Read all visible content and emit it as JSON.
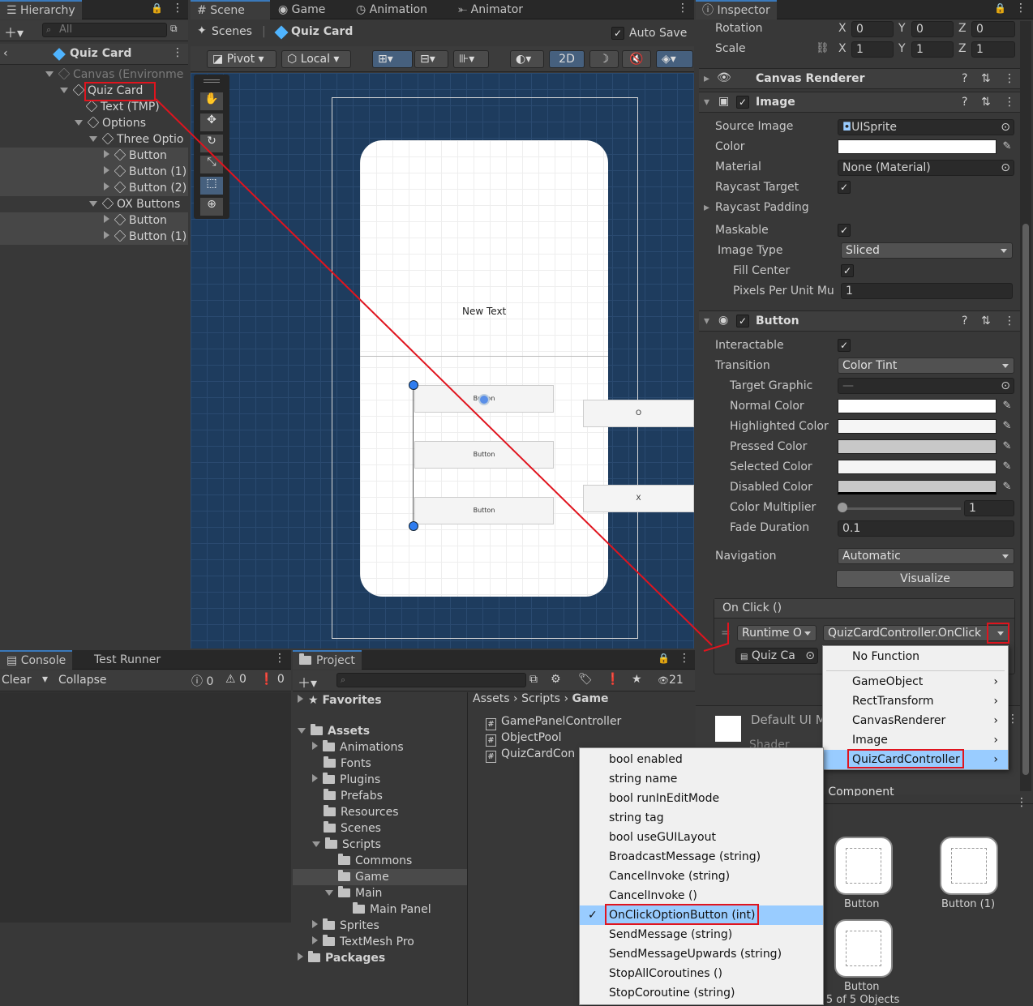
{
  "hierarchy": {
    "tab": "Hierarchy",
    "search_placeholder": "All",
    "scene_title": "Quiz Card",
    "items": [
      {
        "label": "Canvas (Environme"
      },
      {
        "label": "Quiz Card"
      },
      {
        "label": "Text (TMP)"
      },
      {
        "label": "Options"
      },
      {
        "label": "Three Optio"
      },
      {
        "label": "Button"
      },
      {
        "label": "Button (1)"
      },
      {
        "label": "Button (2)"
      },
      {
        "label": "OX Buttons"
      },
      {
        "label": "Button"
      },
      {
        "label": "Button (1)"
      }
    ]
  },
  "scene": {
    "tabs": [
      "Scene",
      "Game",
      "Animation",
      "Animator"
    ],
    "breadcrumb_scenes": "Scenes",
    "breadcrumb_current": "Quiz Card",
    "auto_save": "Auto Save",
    "pivot": "Pivot",
    "local": "Local",
    "mode_2d": "2D",
    "card_text": "New Text",
    "btn1": "Button",
    "btn2": "Button",
    "btn3": "Button",
    "o_label": "O",
    "x_label": "X"
  },
  "inspector": {
    "tab": "Inspector",
    "rotation_label": "Rotation",
    "scale_label": "Scale",
    "axis_x": "X",
    "axis_y": "Y",
    "axis_z": "Z",
    "rotation": [
      "0",
      "0",
      "0"
    ],
    "scale": [
      "1",
      "1",
      "1"
    ],
    "canvas_renderer": "Canvas Renderer",
    "image": {
      "title": "Image",
      "source_image_label": "Source Image",
      "source_image": "UISprite",
      "color_label": "Color",
      "material_label": "Material",
      "material": "None (Material)",
      "raycast_target_label": "Raycast Target",
      "raycast_padding_label": "Raycast Padding",
      "maskable_label": "Maskable",
      "image_type_label": "Image Type",
      "image_type": "Sliced",
      "fill_center_label": "Fill Center",
      "ppu_label": "Pixels Per Unit Mu",
      "ppu": "1"
    },
    "button": {
      "title": "Button",
      "interactable_label": "Interactable",
      "transition_label": "Transition",
      "transition": "Color Tint",
      "target_graphic_label": "Target Graphic",
      "target_graphic": "—",
      "normal_label": "Normal Color",
      "highlighted_label": "Highlighted Color",
      "pressed_label": "Pressed Color",
      "selected_label": "Selected Color",
      "disabled_label": "Disabled Color",
      "multiplier_label": "Color Multiplier",
      "multiplier": "1",
      "fade_label": "Fade Duration",
      "fade": "0.1",
      "navigation_label": "Navigation",
      "navigation": "Automatic",
      "visualize": "Visualize",
      "onclick": "On Click ()",
      "runtime": "Runtime O",
      "function": "QuizCardController.OnClick",
      "object": "Quiz Ca"
    },
    "default_ui": "Default UI M",
    "shader": "Shader",
    "add_component": "d Component"
  },
  "function_menu": {
    "items": [
      "No Function",
      "GameObject",
      "RectTransform",
      "CanvasRenderer",
      "Image",
      "QuizCardController"
    ]
  },
  "method_menu": {
    "items": [
      "bool enabled",
      "string name",
      "bool runInEditMode",
      "string tag",
      "bool useGUILayout",
      "BroadcastMessage (string)",
      "CancelInvoke (string)",
      "CancelInvoke ()",
      "OnClickOptionButton (int)",
      "SendMessage (string)",
      "SendMessageUpwards (string)",
      "StopAllCoroutines ()",
      "StopCoroutine (string)"
    ]
  },
  "console": {
    "tabs": [
      "Console",
      "Test Runner"
    ],
    "clear": "Clear",
    "collapse": "Collapse",
    "counts": [
      "0",
      "0",
      "0"
    ]
  },
  "project": {
    "tab": "Project",
    "count": "21",
    "favorites": "Favorites",
    "assets": "Assets",
    "tree": [
      "Animations",
      "Fonts",
      "Plugins",
      "Prefabs",
      "Resources",
      "Scenes",
      "Scripts",
      "Commons",
      "Game",
      "Main",
      "Main Panel",
      "Sprites",
      "TextMesh Pro"
    ],
    "packages": "Packages",
    "breadcrumb": [
      "Assets",
      "Scripts",
      "Game"
    ],
    "files": [
      "GamePanelController",
      "ObjectPool",
      "QuizCardCon"
    ],
    "preview": [
      "Button",
      "Button (1)",
      "Button"
    ],
    "showing": "wing 5 of 5 Objects"
  },
  "colors": {
    "accent": "#3a79bb",
    "annotation": "#e0141e",
    "scene_bg": "#1e3c5e",
    "selection": "#99ccff"
  }
}
